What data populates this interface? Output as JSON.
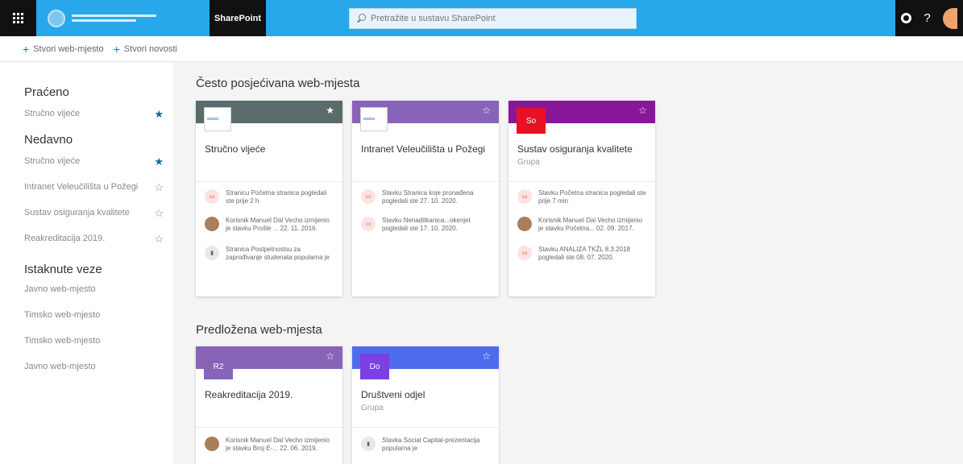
{
  "app": {
    "brand": "SharePoint",
    "search_placeholder": "Pretražite u sustavu SharePoint",
    "help_label": "?"
  },
  "command_bar": {
    "create_site": "Stvori web-mjesto",
    "create_news": "Stvori novosti"
  },
  "leftnav": {
    "following_heading": "Praćeno",
    "following": [
      {
        "label": "Stručno vijeće",
        "starred": true
      }
    ],
    "recent_heading": "Nedavno",
    "recent": [
      {
        "label": "Stručno vijeće",
        "starred": true
      },
      {
        "label": "Intranet Veleučilišta u Požegi",
        "starred": false
      },
      {
        "label": "Sustav osiguranja kvalitete",
        "starred": false
      },
      {
        "label": "Reakreditacija 2019.",
        "starred": false
      }
    ],
    "featured_heading": "Istaknute veze",
    "featured": [
      {
        "label": "Javno web-mjesto"
      },
      {
        "label": "Timsko web-mjesto"
      },
      {
        "label": "Timsko web-mjesto"
      },
      {
        "label": "Javno web-mjesto"
      }
    ]
  },
  "main": {
    "frequent_title": "Često posjećivana web-mjesta",
    "frequent": [
      {
        "title": "Stručno vijeće",
        "subtitle": "",
        "color": "#5a6b6b",
        "activity": [
          {
            "icon": "doc",
            "text": "Stranicu Početna stranica pogledali ste prije 2 h"
          },
          {
            "icon": "person",
            "text": "Korisnik Manuel Dal Vecho izmijenio je stavku Prošle ... 22. 11. 2016."
          },
          {
            "icon": "chart",
            "text": "Stranica Postpetnostsu za zaprođivanje studenata popularna je"
          }
        ]
      },
      {
        "title": "Intranet Veleučilišta u Požegi",
        "subtitle": "",
        "color": "#8764b8",
        "activity": [
          {
            "icon": "doc",
            "text": "Stavku Stranica koje pronađena pogledali ste 27. 10. 2020."
          },
          {
            "icon": "doc",
            "text": "Stavku Nenaditkanica...okenjet pogledali ste 17. 10. 2020."
          }
        ]
      },
      {
        "title": "Sustav osiguranja kvalitete",
        "subtitle": "Grupa",
        "color": "#881798",
        "tile_text": "So",
        "tile_color": "#e81123",
        "activity": [
          {
            "icon": "doc",
            "text": "Stavku Početna stranica pogledali ste prije 7 min"
          },
          {
            "icon": "person",
            "text": "Korisnik Manuel Dal Vecho izmijenio je stavku Početna... 02. 09. 2017."
          },
          {
            "icon": "doc",
            "text": "Stavku ANALIZA TKŽL 8.3.2018 pogledali ste 08. 07. 2020."
          }
        ]
      }
    ],
    "suggested_title": "Predložena web-mjesta",
    "suggested": [
      {
        "title": "Reakreditacija 2019.",
        "subtitle": "",
        "color": "#8764b8",
        "tile_text": "R2",
        "tile_color": "#8764b8",
        "activity": [
          {
            "icon": "person",
            "text": "Korisnik Manuel Dal Vecho izmijenio je stavku Broj E-... 22. 06. 2019."
          }
        ]
      },
      {
        "title": "Društveni odjel",
        "subtitle": "Grupa",
        "color": "#4f6bed",
        "tile_text": "Do",
        "tile_color": "#7b3fe4",
        "activity": [
          {
            "icon": "chart",
            "text": "Stavka Social Capital-prezentacija popularna je"
          }
        ]
      }
    ]
  }
}
